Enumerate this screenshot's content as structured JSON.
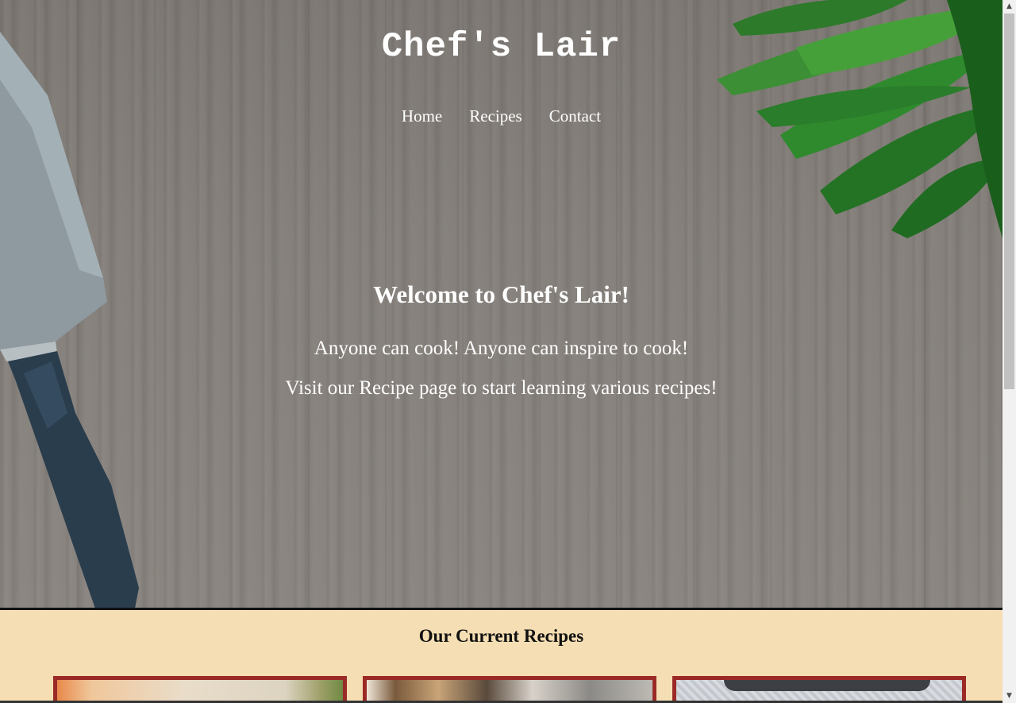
{
  "header": {
    "site_title": "Chef's Lair",
    "nav": [
      "Home",
      "Recipes",
      "Contact"
    ]
  },
  "hero": {
    "heading": "Welcome to Chef's Lair!",
    "line1": "Anyone can cook! Anyone can inspire to cook!",
    "line2": "Visit our Recipe page to start learning various recipes!"
  },
  "recipes": {
    "heading": "Our Current Recipes",
    "cards": 3
  },
  "colors": {
    "accent_background": "#f5deb3",
    "card_border": "#9b2a26",
    "text_light": "#ffffff"
  }
}
